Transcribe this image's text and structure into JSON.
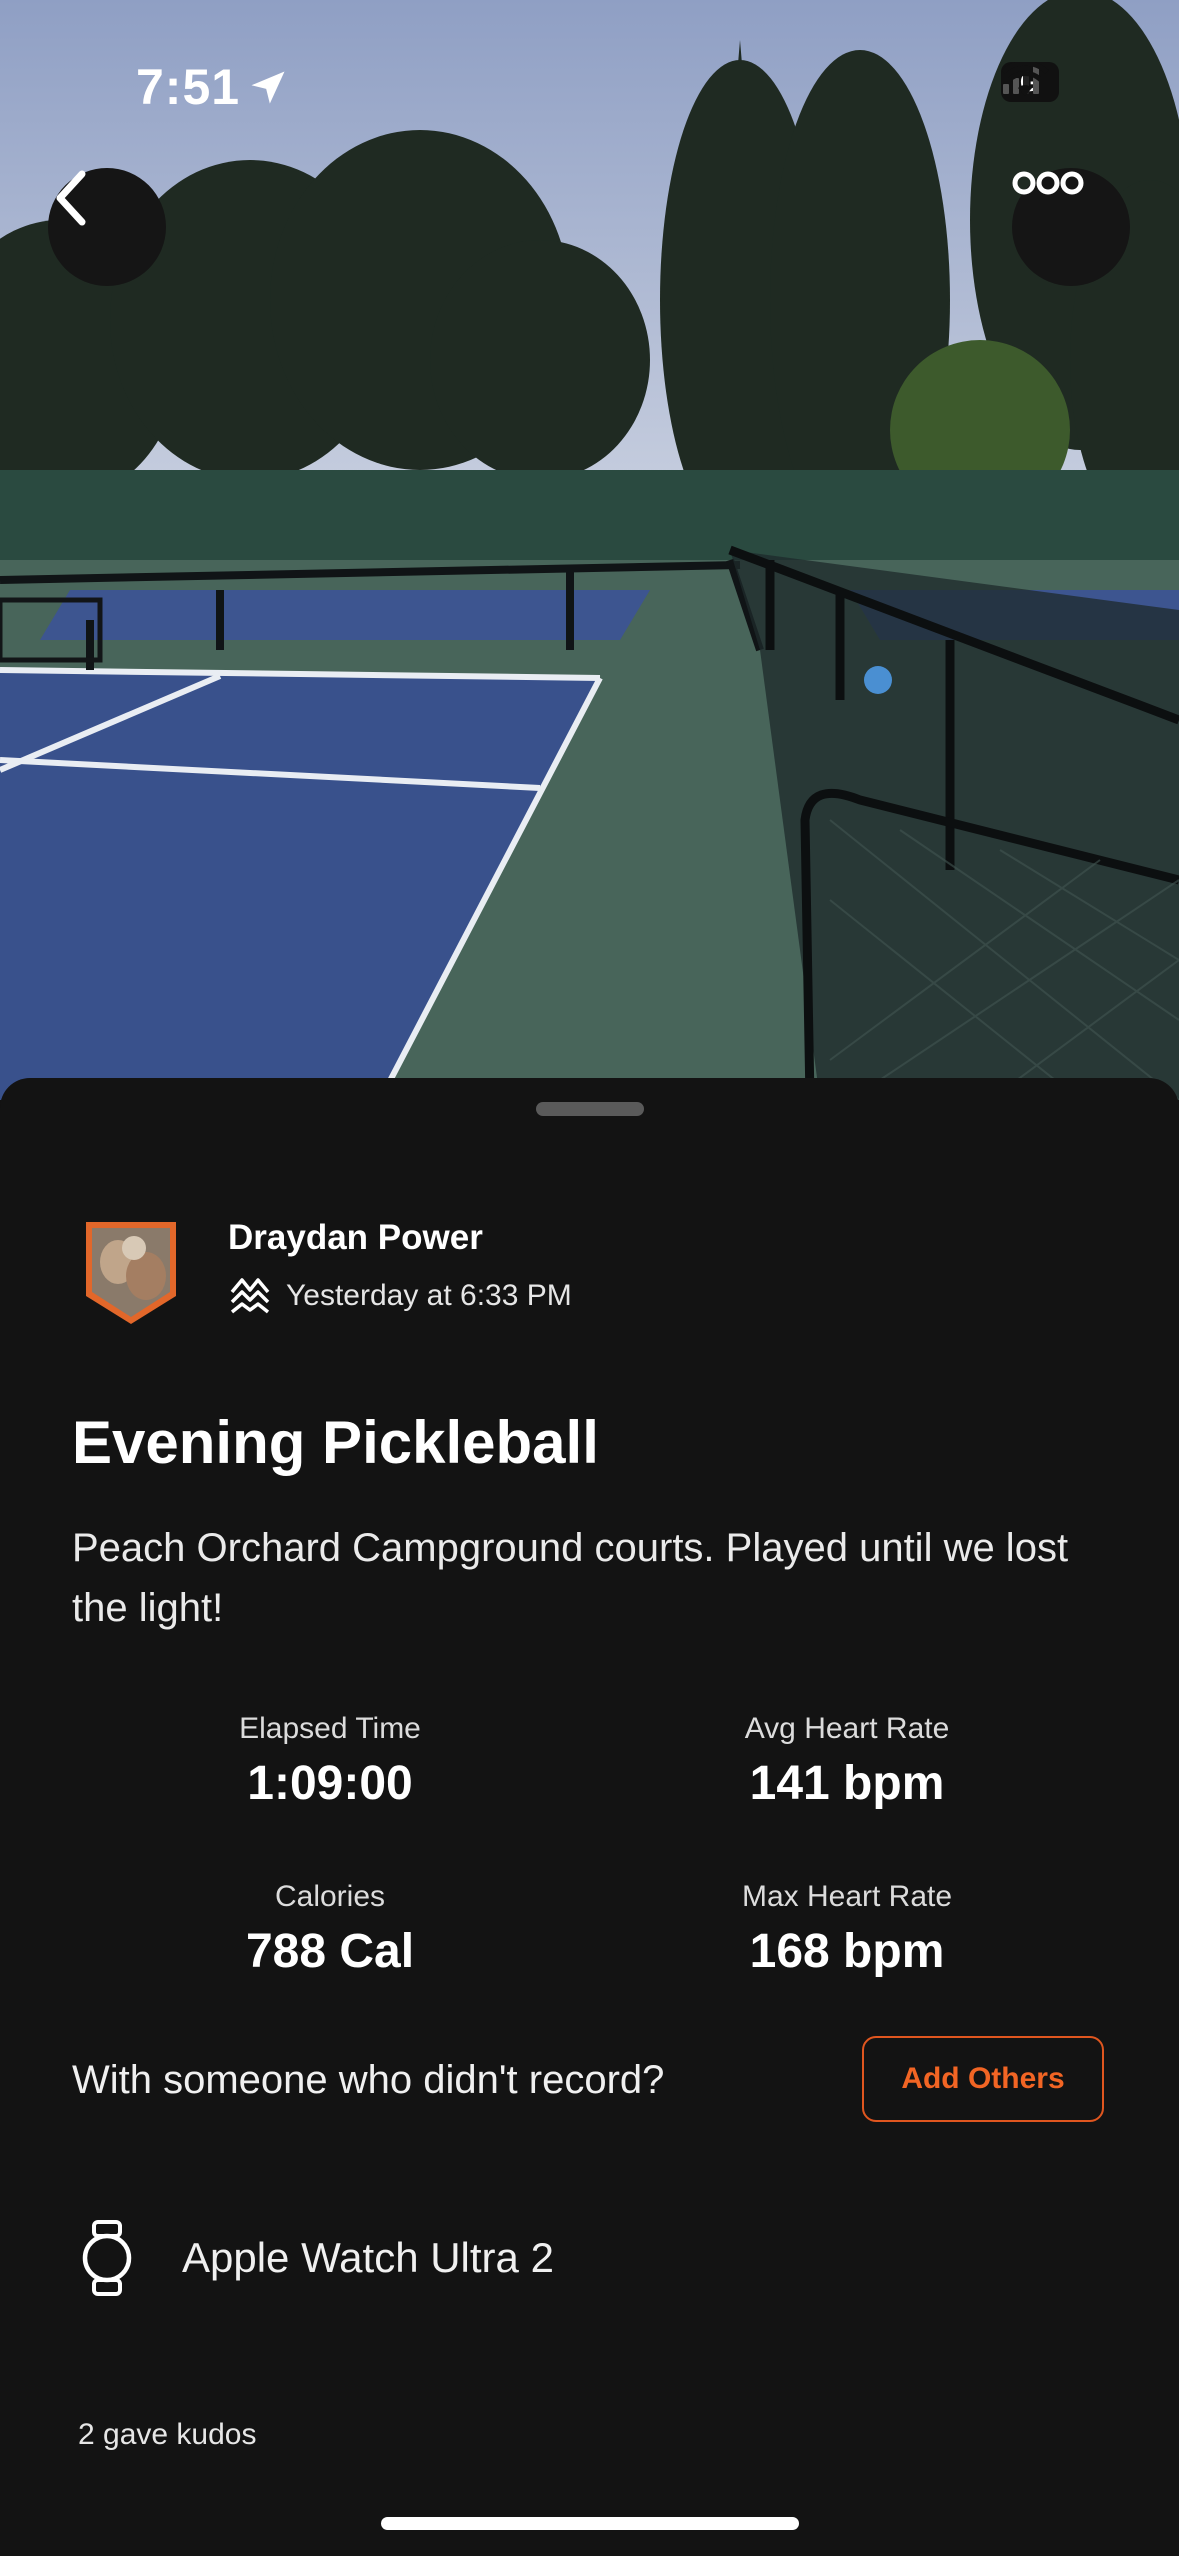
{
  "status_bar": {
    "time": "7:51",
    "battery_label": "G"
  },
  "nav": {
    "back_icon": "chevron-left-icon",
    "more_icon": "more-horizontal-icon"
  },
  "athlete": {
    "name": "Draydan Power",
    "timestamp": "Yesterday at 6:33 PM"
  },
  "activity": {
    "title": "Evening Pickleball",
    "description": "Peach Orchard Campground courts. Played until we lost the light!"
  },
  "stats": [
    {
      "label": "Elapsed Time",
      "value": "1:09:00"
    },
    {
      "label": "Avg Heart Rate",
      "value": "141 bpm"
    },
    {
      "label": "Calories",
      "value": "788 Cal"
    },
    {
      "label": "Max Heart Rate",
      "value": "168 bpm"
    }
  ],
  "add_others": {
    "prompt": "With someone who didn't record?",
    "button_label": "Add Others"
  },
  "device": {
    "name": "Apple Watch Ultra 2"
  },
  "kudos": {
    "text": "2 gave kudos"
  },
  "colors": {
    "accent": "#f26524",
    "background": "#131313",
    "court_blue": "#3c5390",
    "court_green": "#4a6a5c"
  }
}
